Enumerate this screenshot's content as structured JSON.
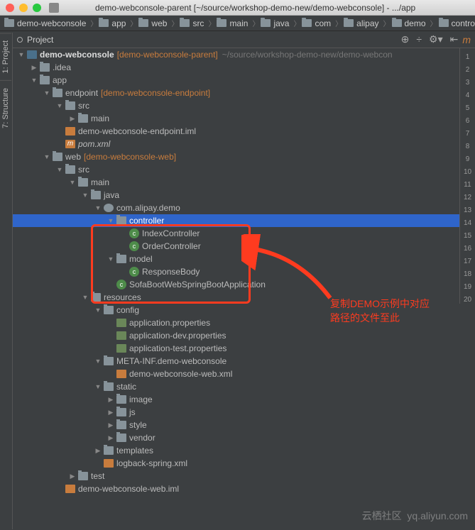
{
  "window": {
    "title": "demo-webconsole-parent [~/source/workshop-demo-new/demo-webconsole] - .../app"
  },
  "breadcrumb": [
    "demo-webconsole",
    "app",
    "web",
    "src",
    "main",
    "java",
    "com",
    "alipay",
    "demo",
    "controlle"
  ],
  "toolbar": {
    "view": "Project"
  },
  "leftTabs": [
    "1: Project",
    "7: Structure"
  ],
  "gutter_m": "m",
  "lineNumbers": [
    1,
    2,
    3,
    4,
    5,
    6,
    7,
    8,
    9,
    10,
    11,
    12,
    13,
    14,
    15,
    16,
    17,
    18,
    19,
    20
  ],
  "tree": [
    {
      "d": 0,
      "a": "down",
      "i": "root",
      "t": "demo-webconsole",
      "br": "[demo-webconsole-parent]",
      "h": "~/source/workshop-demo-new/demo-webcon"
    },
    {
      "d": 1,
      "a": "right",
      "i": "folder",
      "t": ".idea"
    },
    {
      "d": 1,
      "a": "down",
      "i": "folder",
      "t": "app"
    },
    {
      "d": 2,
      "a": "down",
      "i": "folder",
      "t": "endpoint",
      "br": "[demo-webconsole-endpoint]"
    },
    {
      "d": 3,
      "a": "down",
      "i": "folder",
      "t": "src"
    },
    {
      "d": 4,
      "a": "right",
      "i": "folder",
      "t": "main"
    },
    {
      "d": 3,
      "a": "none",
      "i": "iml",
      "t": "demo-webconsole-endpoint.iml"
    },
    {
      "d": 3,
      "a": "none",
      "i": "maven",
      "t": "pom.xml",
      "it": true
    },
    {
      "d": 2,
      "a": "down",
      "i": "folder",
      "t": "web",
      "br": "[demo-webconsole-web]"
    },
    {
      "d": 3,
      "a": "down",
      "i": "folder",
      "t": "src"
    },
    {
      "d": 4,
      "a": "down",
      "i": "folder",
      "t": "main"
    },
    {
      "d": 5,
      "a": "down",
      "i": "folder",
      "t": "java"
    },
    {
      "d": 6,
      "a": "down",
      "i": "pkg",
      "t": "com.alipay.demo"
    },
    {
      "d": 7,
      "a": "down",
      "i": "folder",
      "t": "controller",
      "sel": true
    },
    {
      "d": 8,
      "a": "none",
      "i": "class",
      "t": "IndexController"
    },
    {
      "d": 8,
      "a": "none",
      "i": "class",
      "t": "OrderController"
    },
    {
      "d": 7,
      "a": "down",
      "i": "folder",
      "t": "model"
    },
    {
      "d": 8,
      "a": "none",
      "i": "class",
      "t": "ResponseBody"
    },
    {
      "d": 7,
      "a": "none",
      "i": "class",
      "t": "SofaBootWebSpringBootApplication"
    },
    {
      "d": 5,
      "a": "down",
      "i": "folder",
      "t": "resources"
    },
    {
      "d": 6,
      "a": "down",
      "i": "folder",
      "t": "config"
    },
    {
      "d": 7,
      "a": "none",
      "i": "props",
      "t": "application.properties"
    },
    {
      "d": 7,
      "a": "none",
      "i": "props",
      "t": "application-dev.properties"
    },
    {
      "d": 7,
      "a": "none",
      "i": "props",
      "t": "application-test.properties"
    },
    {
      "d": 6,
      "a": "down",
      "i": "folder",
      "t": "META-INF.demo-webconsole"
    },
    {
      "d": 7,
      "a": "none",
      "i": "xml",
      "t": "demo-webconsole-web.xml"
    },
    {
      "d": 6,
      "a": "down",
      "i": "folder",
      "t": "static"
    },
    {
      "d": 7,
      "a": "right",
      "i": "folder",
      "t": "image"
    },
    {
      "d": 7,
      "a": "right",
      "i": "folder",
      "t": "js"
    },
    {
      "d": 7,
      "a": "right",
      "i": "folder",
      "t": "style"
    },
    {
      "d": 7,
      "a": "right",
      "i": "folder",
      "t": "vendor"
    },
    {
      "d": 6,
      "a": "right",
      "i": "folder",
      "t": "templates"
    },
    {
      "d": 6,
      "a": "none",
      "i": "xml",
      "t": "logback-spring.xml"
    },
    {
      "d": 4,
      "a": "right",
      "i": "folder",
      "t": "test"
    },
    {
      "d": 3,
      "a": "none",
      "i": "iml",
      "t": "demo-webconsole-web.iml"
    }
  ],
  "annotation": {
    "line1": "复制DEMO示例中对应",
    "line2": "路径的文件至此"
  },
  "watermark": {
    "brand": "云栖社区",
    "url": "yq.aliyun.com"
  }
}
